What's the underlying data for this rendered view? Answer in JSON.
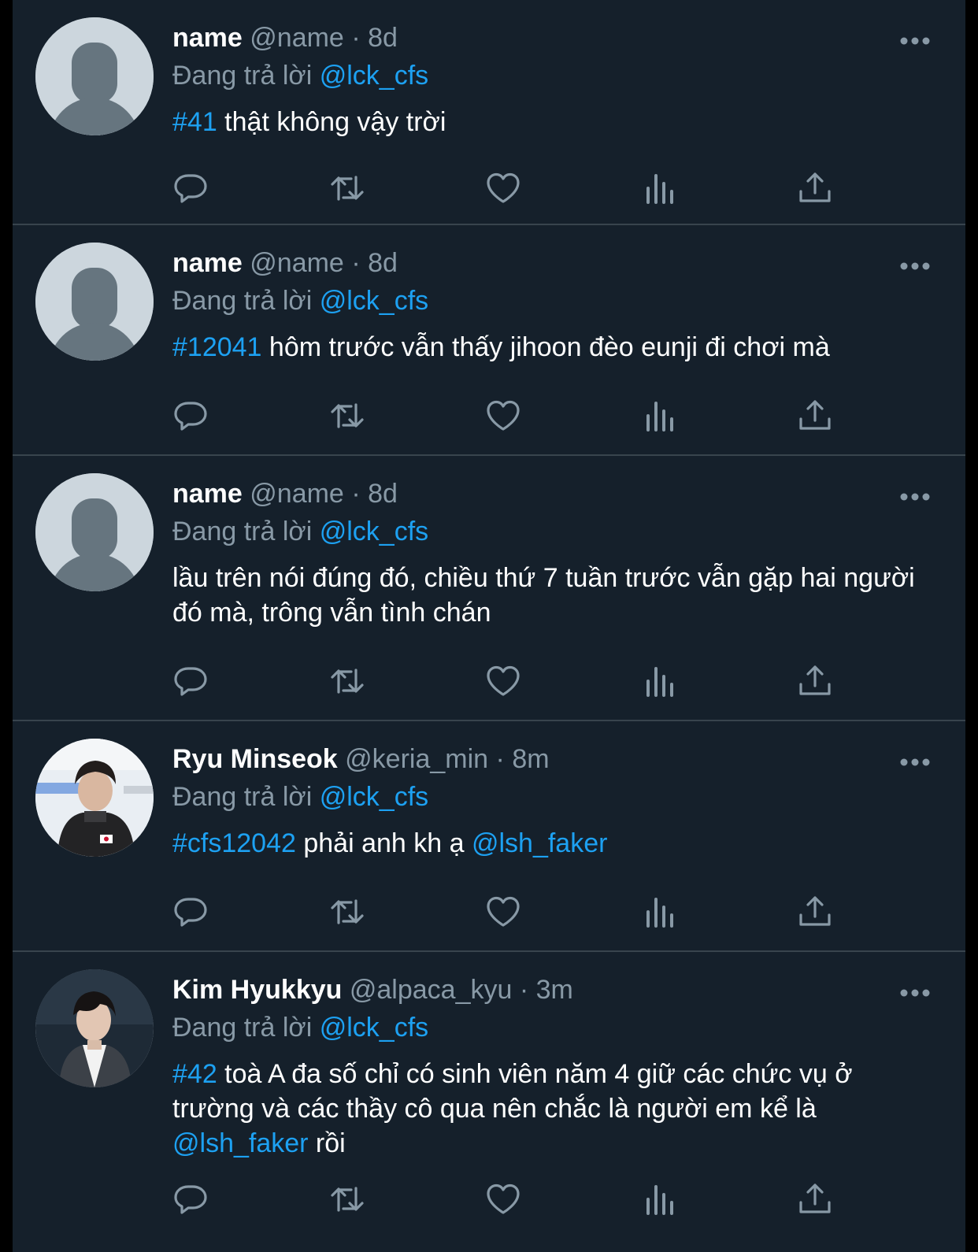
{
  "replying_label": "Đang trả lời",
  "tweets": [
    {
      "display_name": "name",
      "handle": "@name",
      "separator": "·",
      "time": "8d",
      "reply_to": "@lck_cfs",
      "tag": "#41",
      "text": " thật không vậy trời",
      "text2": "",
      "avatar": "default"
    },
    {
      "display_name": "name",
      "handle": "@name",
      "separator": "·",
      "time": "8d",
      "reply_to": "@lck_cfs",
      "tag": "#12041",
      "text": " hôm trước vẫn thấy jihoon đèo eunji đi chơi mà",
      "text2": "",
      "avatar": "default"
    },
    {
      "display_name": "name",
      "handle": "@name",
      "separator": "·",
      "time": "8d",
      "reply_to": "@lck_cfs",
      "tag": "",
      "text": "lầu trên nói đúng đó, chiều thứ 7 tuần trước vẫn gặp hai người đó mà, trông vẫn tình chán",
      "text2": "",
      "avatar": "default"
    },
    {
      "display_name": "Ryu Minseok",
      "handle": "@keria_min",
      "separator": "·",
      "time": "8m",
      "reply_to": "@lck_cfs",
      "tag": "#cfs12042",
      "text": " phải anh kh ạ ",
      "mention_end": "@lsh_faker",
      "text2": "",
      "avatar": "photo-player-1"
    },
    {
      "display_name": "Kim Hyukkyu",
      "handle": "@alpaca_kyu",
      "separator": "·",
      "time": "3m",
      "reply_to": "@lck_cfs",
      "tag": "#42",
      "text": " toà A đa số chỉ có sinh viên năm 4 giữ các chức vụ ở trường và các thầy cô qua nên chắc là người em kể là ",
      "mention_end": "@lsh_faker",
      "text2": " rồi",
      "avatar": "photo-player-2"
    }
  ],
  "icons": [
    "reply-icon",
    "retweet-icon",
    "like-icon",
    "views-icon",
    "share-icon",
    "more-icon"
  ],
  "colors": {
    "background": "#15202b",
    "divider": "#38444d",
    "text": "#ffffff",
    "secondary": "#8899a6",
    "accent": "#1da1f2"
  }
}
